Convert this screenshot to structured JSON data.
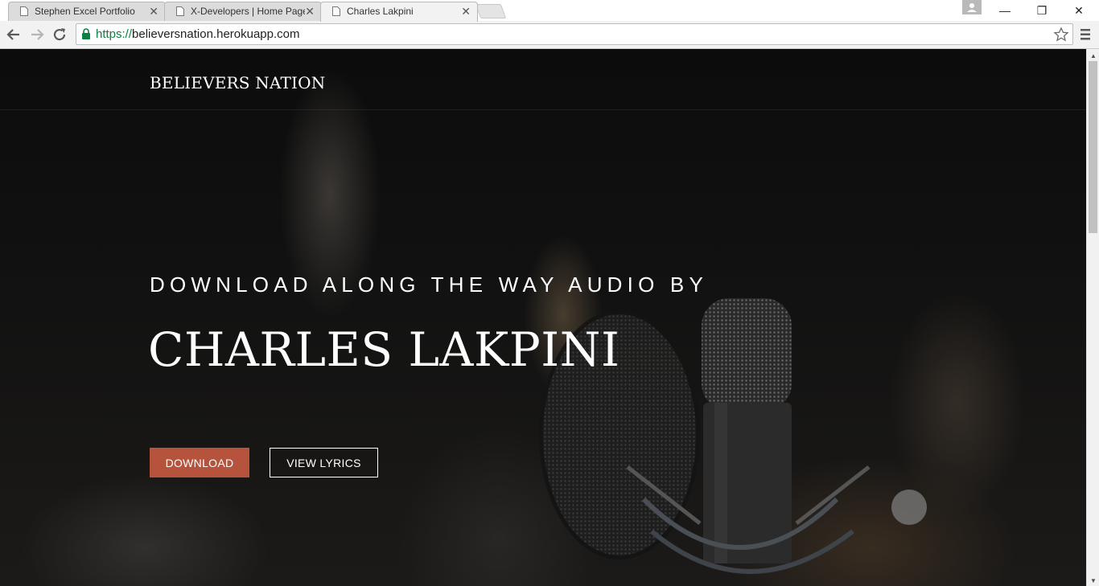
{
  "browser": {
    "tabs": [
      {
        "title": "Stephen Excel Portfolio",
        "close": "✕"
      },
      {
        "title": "X-Developers | Home Page",
        "close": "✕"
      },
      {
        "title": "Charles Lakpini",
        "close": "✕"
      }
    ],
    "window_controls": {
      "minimize": "—",
      "restore": "❐",
      "close": "✕"
    },
    "url": {
      "scheme": "https://",
      "host": "believersnation.herokuapp.com"
    }
  },
  "page": {
    "brand": "BELIEVERS NATION",
    "subtitle": "DOWNLOAD ALONG THE WAY AUDIO BY",
    "headline": "CHARLES LAKPINI",
    "buttons": {
      "download": "DOWNLOAD",
      "view_lyrics": "VIEW LYRICS"
    },
    "accent_color": "#b5533c"
  },
  "scrollbar": {
    "up": "▲",
    "down": "▼"
  }
}
